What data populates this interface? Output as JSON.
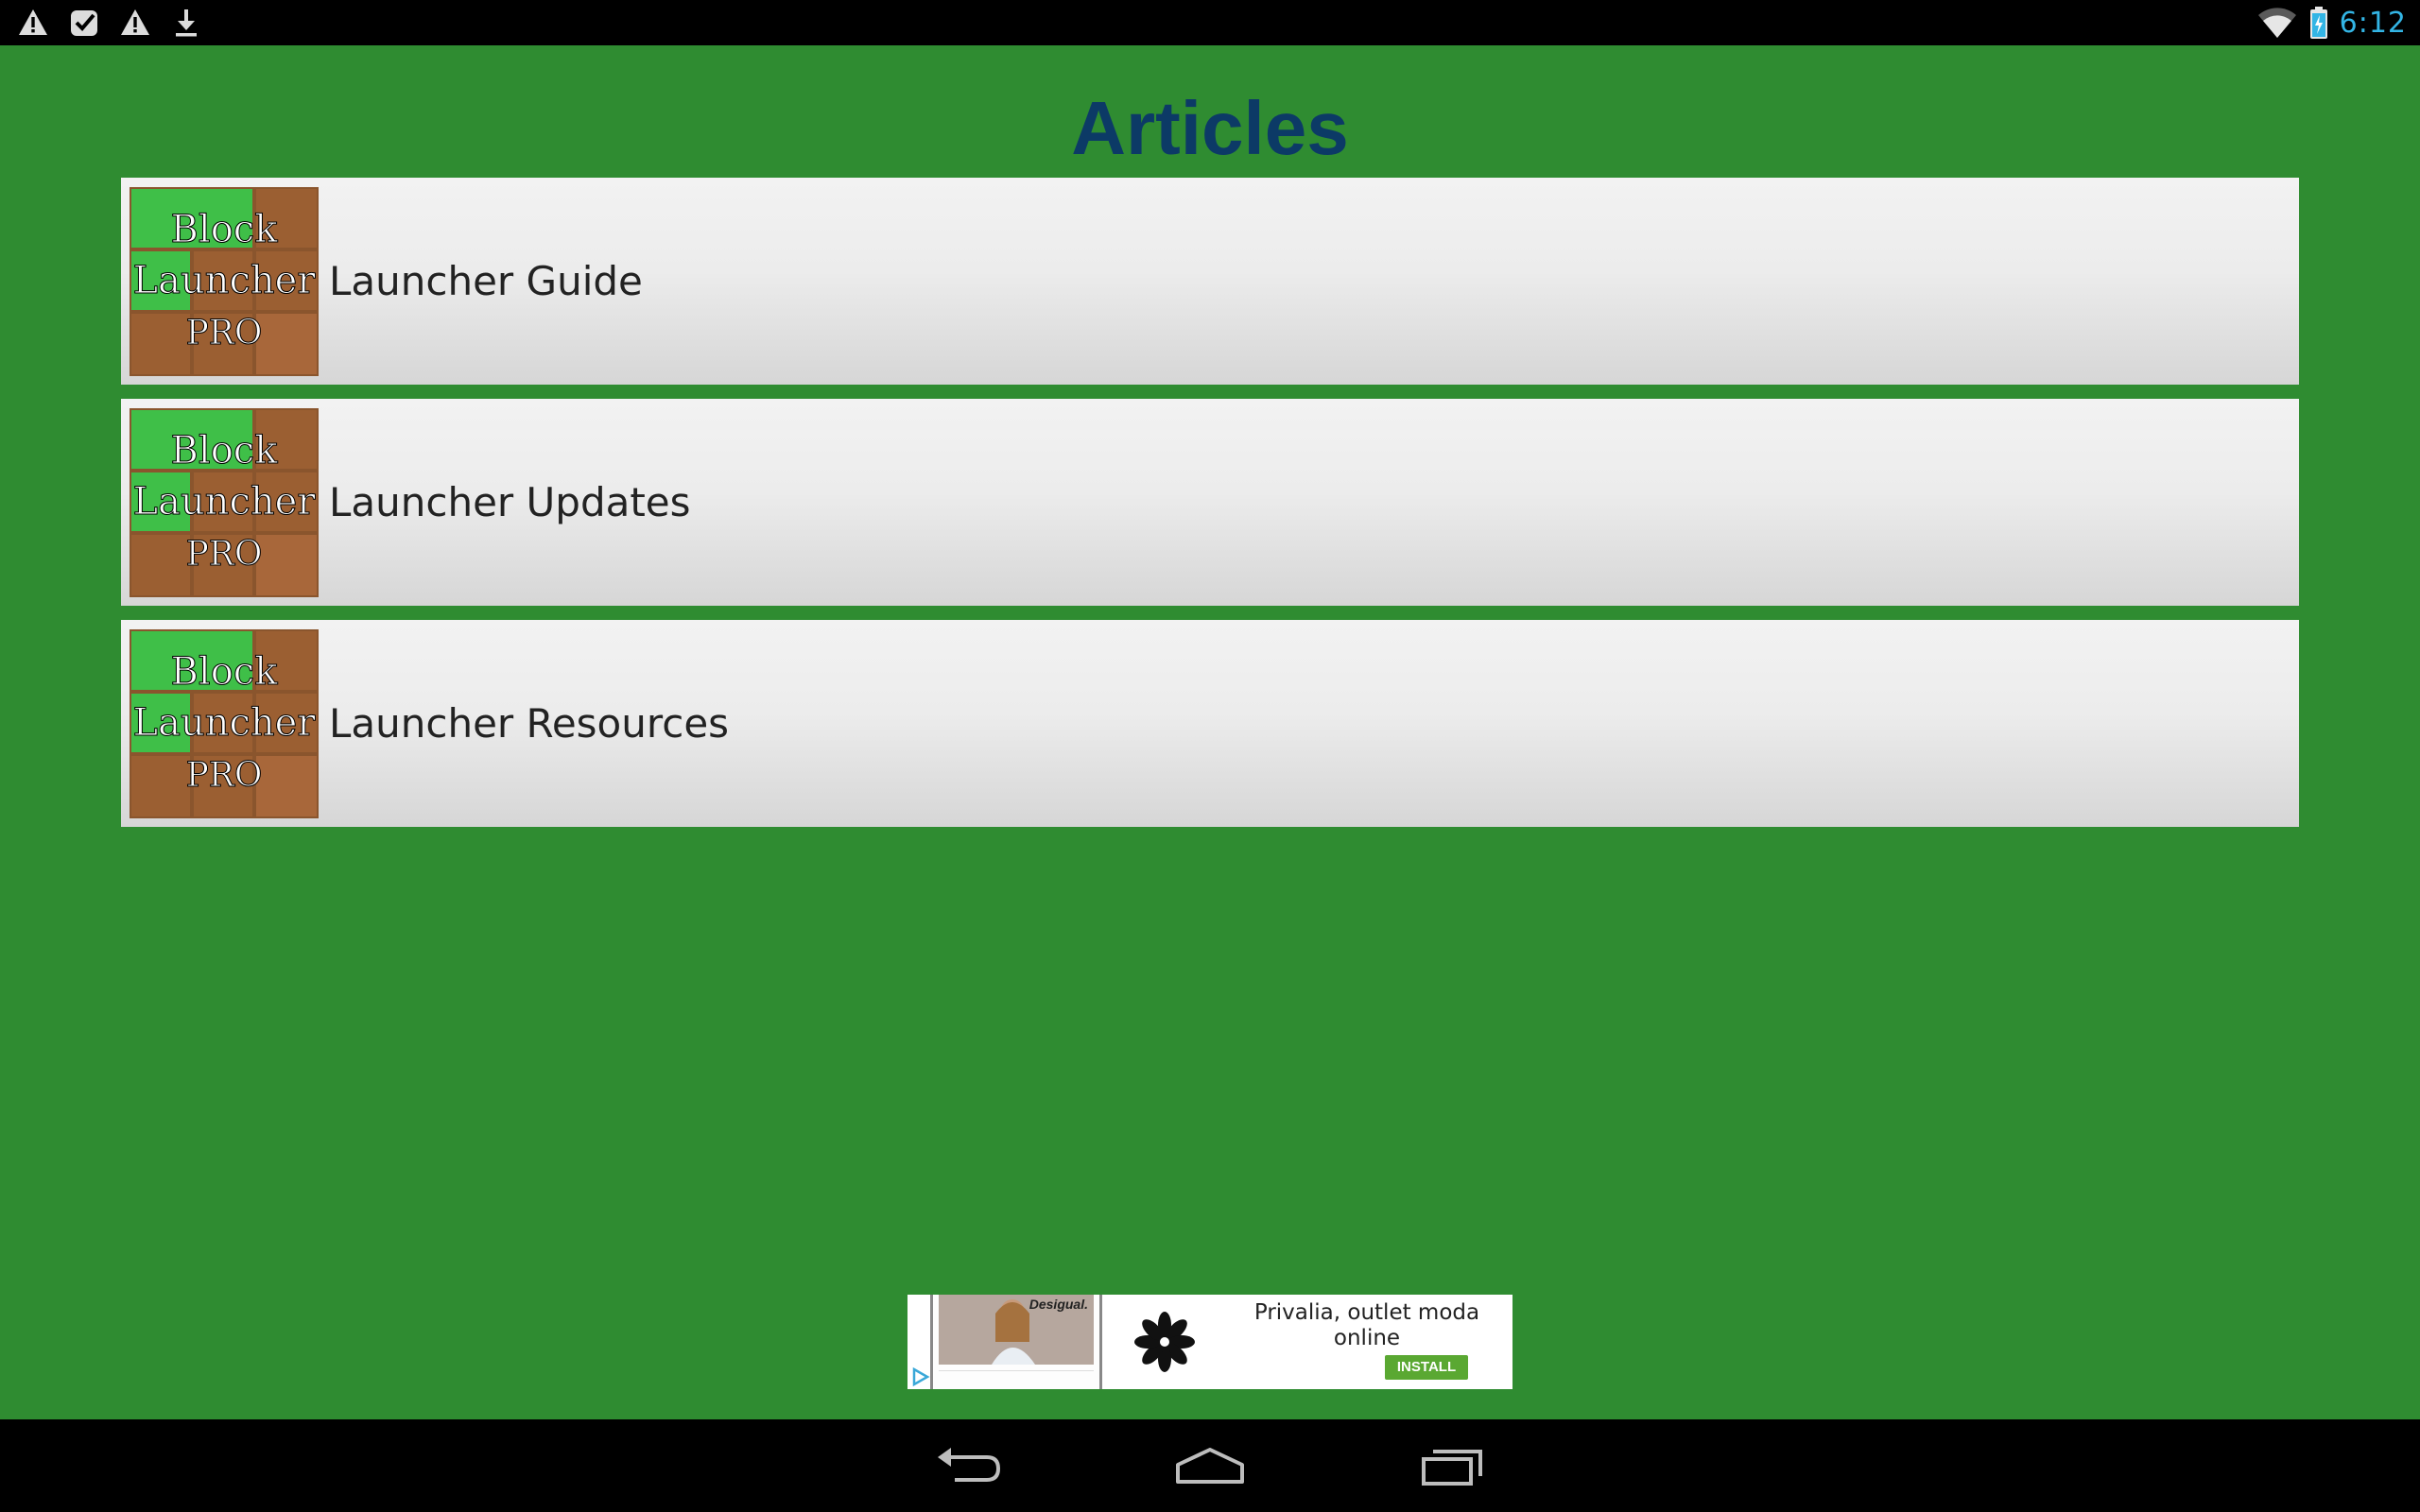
{
  "status_bar": {
    "time": "6:12",
    "left_icons": [
      "warning-icon",
      "checkbox-icon",
      "warning-icon",
      "download-icon"
    ],
    "right_icons": [
      "wifi-icon",
      "battery-charging-icon"
    ],
    "time_color": "#33b5e5"
  },
  "header": {
    "title": "Articles",
    "title_color": "#0c3a66"
  },
  "theme": {
    "background": "#2f8c31"
  },
  "thumbnail": {
    "line1": "Block",
    "line2": "Launcher",
    "line3": "PRO"
  },
  "articles": [
    {
      "label": "Launcher Guide"
    },
    {
      "label": "Launcher Updates"
    },
    {
      "label": "Launcher Resources"
    }
  ],
  "ad": {
    "brand": "Desigual.",
    "headline": "Privalia, outlet moda online",
    "cta": "INSTALL",
    "cta_color": "#5aa832"
  },
  "nav_bar": {
    "buttons": [
      "back-icon",
      "home-icon",
      "recent-apps-icon"
    ]
  }
}
